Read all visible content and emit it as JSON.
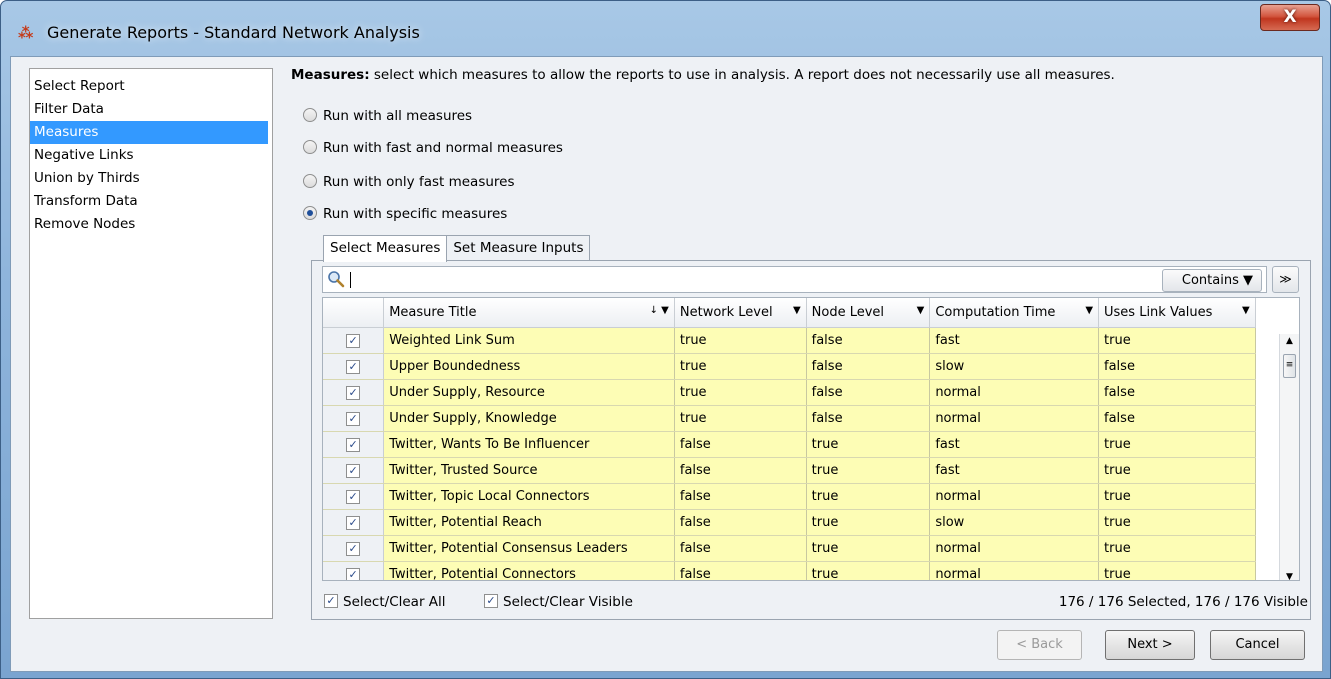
{
  "window": {
    "title": "Generate Reports - Standard Network Analysis",
    "close_label": "X"
  },
  "sidebar": {
    "items": [
      {
        "label": "Select Report",
        "selected": false
      },
      {
        "label": "Filter Data",
        "selected": false
      },
      {
        "label": "Measures",
        "selected": true
      },
      {
        "label": "Negative Links",
        "selected": false
      },
      {
        "label": "Union by Thirds",
        "selected": false
      },
      {
        "label": "Transform Data",
        "selected": false
      },
      {
        "label": "Remove Nodes",
        "selected": false
      }
    ]
  },
  "main": {
    "desc_bold": "Measures:",
    "desc_text": " select which measures to allow the reports to use in analysis. A report does not necessarily use all measures.",
    "radios": [
      {
        "label": "Run with all measures",
        "checked": false
      },
      {
        "label": "Run with fast and normal measures",
        "checked": false
      },
      {
        "label": "Run with only fast measures",
        "checked": false
      },
      {
        "label": "Run with specific measures",
        "checked": true
      }
    ],
    "tabs": [
      {
        "label": "Select Measures",
        "active": true
      },
      {
        "label": "Set Measure Inputs",
        "active": false
      }
    ]
  },
  "search": {
    "value": "",
    "mode": "Contains",
    "expand_icon": "double-chevron-down-icon"
  },
  "table": {
    "columns": [
      "Measure Title",
      "Network Level",
      "Node Level",
      "Computation Time",
      "Uses Link Values"
    ],
    "sort_indicator": "↓",
    "rows": [
      {
        "checked": true,
        "title": "Weighted Link Sum",
        "network": "true",
        "node": "false",
        "time": "fast",
        "link": "true"
      },
      {
        "checked": true,
        "title": "Upper Boundedness",
        "network": "true",
        "node": "false",
        "time": "slow",
        "link": "false"
      },
      {
        "checked": true,
        "title": "Under Supply, Resource",
        "network": "true",
        "node": "false",
        "time": "normal",
        "link": "false"
      },
      {
        "checked": true,
        "title": "Under Supply, Knowledge",
        "network": "true",
        "node": "false",
        "time": "normal",
        "link": "false"
      },
      {
        "checked": true,
        "title": "Twitter, Wants To Be Influencer",
        "network": "false",
        "node": "true",
        "time": "fast",
        "link": "true"
      },
      {
        "checked": true,
        "title": "Twitter, Trusted Source",
        "network": "false",
        "node": "true",
        "time": "fast",
        "link": "true"
      },
      {
        "checked": true,
        "title": "Twitter, Topic Local Connectors",
        "network": "false",
        "node": "true",
        "time": "normal",
        "link": "true"
      },
      {
        "checked": true,
        "title": "Twitter, Potential Reach",
        "network": "false",
        "node": "true",
        "time": "slow",
        "link": "true"
      },
      {
        "checked": true,
        "title": "Twitter, Potential Consensus Leaders",
        "network": "false",
        "node": "true",
        "time": "normal",
        "link": "true"
      },
      {
        "checked": true,
        "title": "Twitter, Potential Connectors",
        "network": "false",
        "node": "true",
        "time": "normal",
        "link": "true"
      }
    ]
  },
  "footer": {
    "select_all": "Select/Clear All",
    "select_visible": "Select/Clear Visible",
    "status": "176 / 176 Selected, 176 / 176 Visible"
  },
  "buttons": {
    "back": "< Back",
    "next": "Next >",
    "cancel": "Cancel"
  },
  "colors": {
    "selection": "#3399ff",
    "row_highlight": "#fdfdb5"
  }
}
